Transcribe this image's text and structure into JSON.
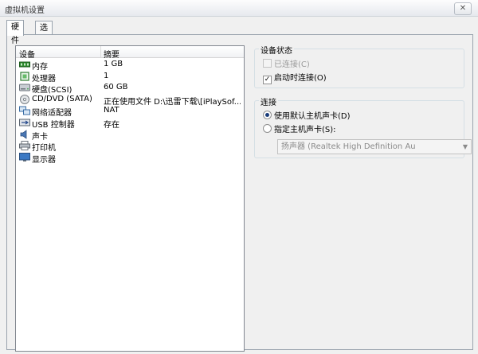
{
  "window": {
    "title": "虚拟机设置",
    "close_glyph": "✕"
  },
  "tabs": [
    {
      "label": "硬件",
      "active": true
    },
    {
      "label": "选项",
      "active": false
    }
  ],
  "device_list": {
    "columns": [
      "设备",
      "摘要"
    ],
    "rows": [
      {
        "name": "内存",
        "summary": "1 GB",
        "icon": "memory-icon"
      },
      {
        "name": "处理器",
        "summary": "1",
        "icon": "processor-icon"
      },
      {
        "name": "硬盘(SCSI)",
        "summary": "60 GB",
        "icon": "hard-disk-icon"
      },
      {
        "name": "CD/DVD (SATA)",
        "summary": "正在使用文件 D:\\迅雷下载\\[iPlaySof...",
        "icon": "cd-dvd-icon"
      },
      {
        "name": "网络适配器",
        "summary": "NAT",
        "icon": "network-adapter-icon"
      },
      {
        "name": "USB 控制器",
        "summary": "存在",
        "icon": "usb-controller-icon"
      },
      {
        "name": "声卡",
        "summary": "",
        "icon": "sound-card-icon"
      },
      {
        "name": "打印机",
        "summary": "",
        "icon": "printer-icon"
      },
      {
        "name": "显示器",
        "summary": "",
        "icon": "display-icon"
      }
    ]
  },
  "device_status": {
    "title": "设备状态",
    "connected": {
      "label": "已连接(C)",
      "checked": false,
      "disabled": true
    },
    "connect_on_power_on": {
      "label": "启动时连接(O)",
      "checked": true
    }
  },
  "connection": {
    "title": "连接",
    "use_default": {
      "label": "使用默认主机声卡(D)",
      "selected": true
    },
    "specify": {
      "label": "指定主机声卡(S):",
      "selected": false
    },
    "select_value": "扬声器 (Realtek High Definition Au"
  },
  "colors": {
    "accent": "#1a3c7a",
    "border": "#9aa3ad",
    "disabled_text": "#9a9a9a"
  }
}
